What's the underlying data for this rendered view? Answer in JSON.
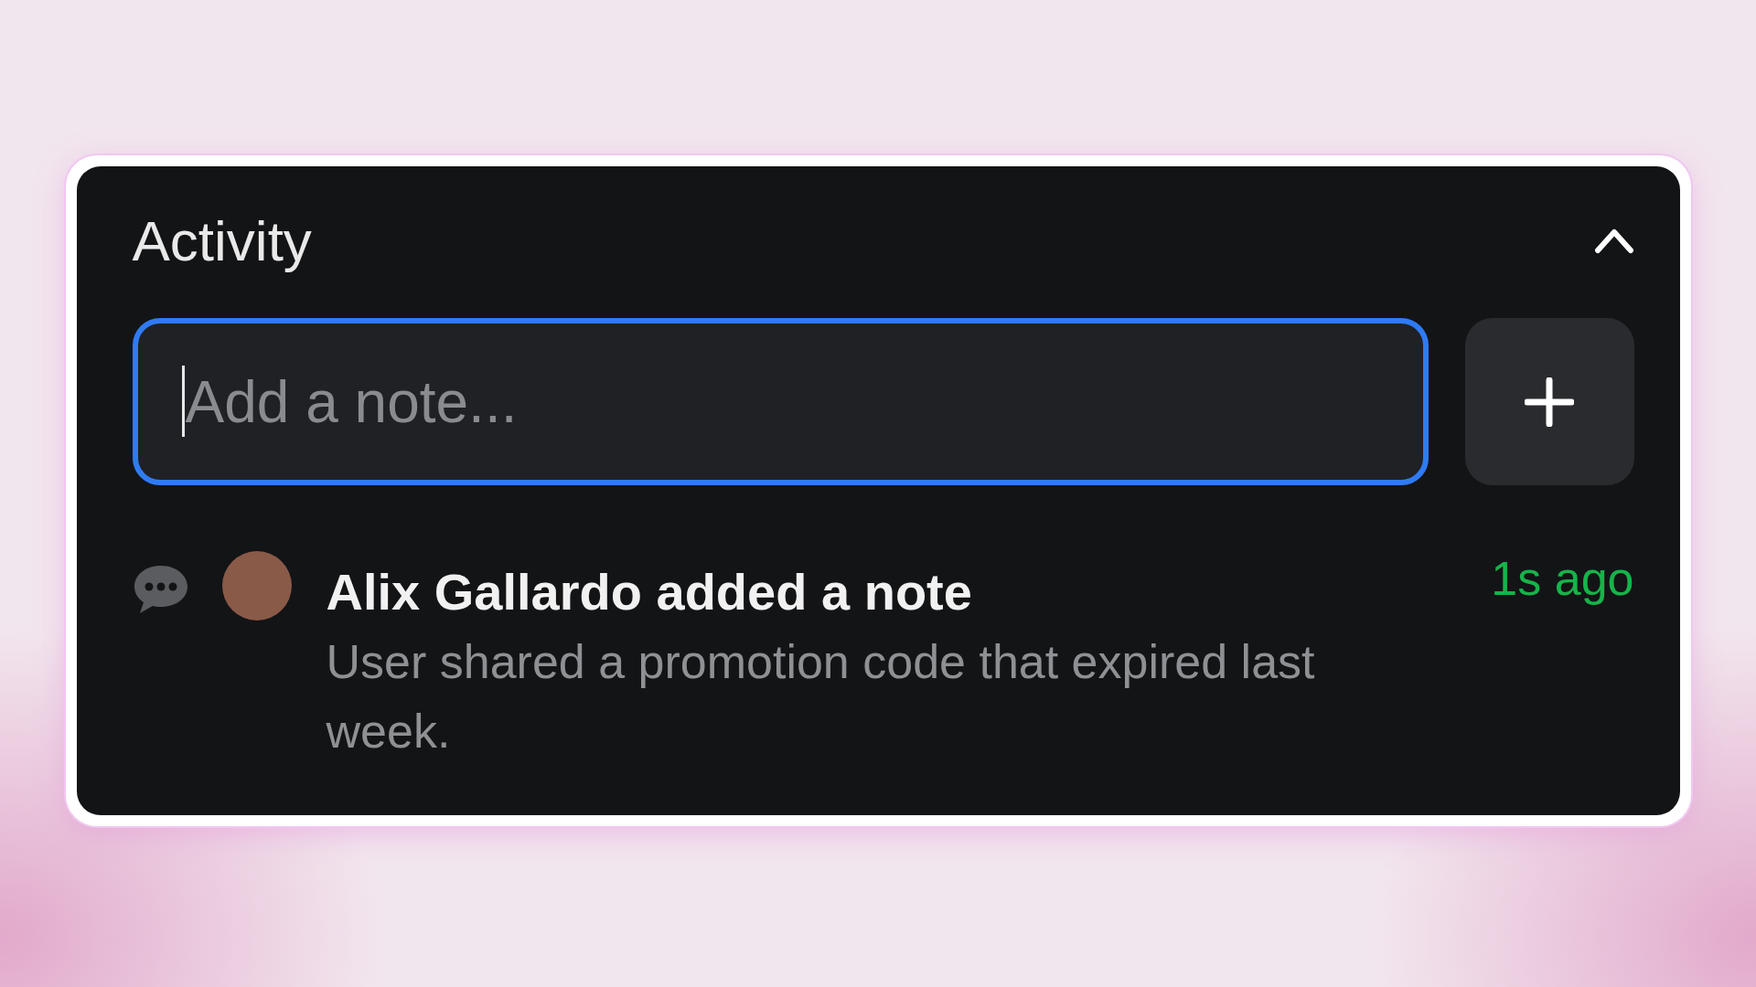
{
  "panel": {
    "title": "Activity",
    "expanded": true
  },
  "note_input": {
    "placeholder": "Add a note...",
    "focused": true
  },
  "activity": [
    {
      "kind": "note",
      "summary": "**Alix Gallardo** added a note",
      "body": "User shared a promotion code that expired last week.",
      "time": "1s ago"
    }
  ]
}
